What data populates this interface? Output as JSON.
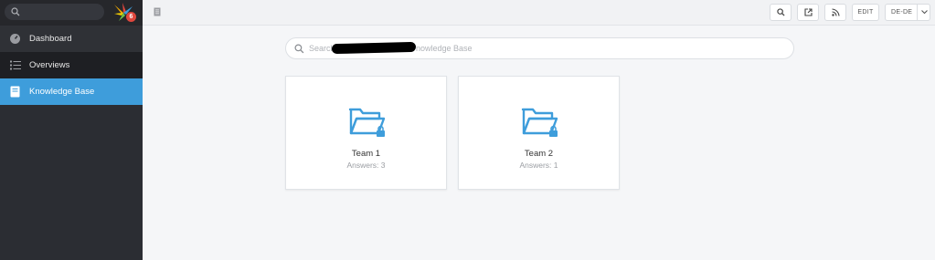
{
  "colors": {
    "accent": "#3e9ddb",
    "sidebar_bg": "#2b2d33",
    "badge": "#e0473d"
  },
  "sidebar": {
    "badge_count": "6",
    "items": [
      {
        "label": "Dashboard",
        "icon": "dashboard-icon"
      },
      {
        "label": "Overviews",
        "icon": "list-icon"
      },
      {
        "label": "Knowledge Base",
        "icon": "book-icon",
        "active": true
      }
    ]
  },
  "toolbar": {
    "edit_label": "EDIT",
    "language_label": "DE-DE"
  },
  "search": {
    "prefix": "Search",
    "suffix": "nowledge Base"
  },
  "categories": [
    {
      "title": "Team 1",
      "answers": "Answers: 3"
    },
    {
      "title": "Team 2",
      "answers": "Answers: 1"
    }
  ]
}
